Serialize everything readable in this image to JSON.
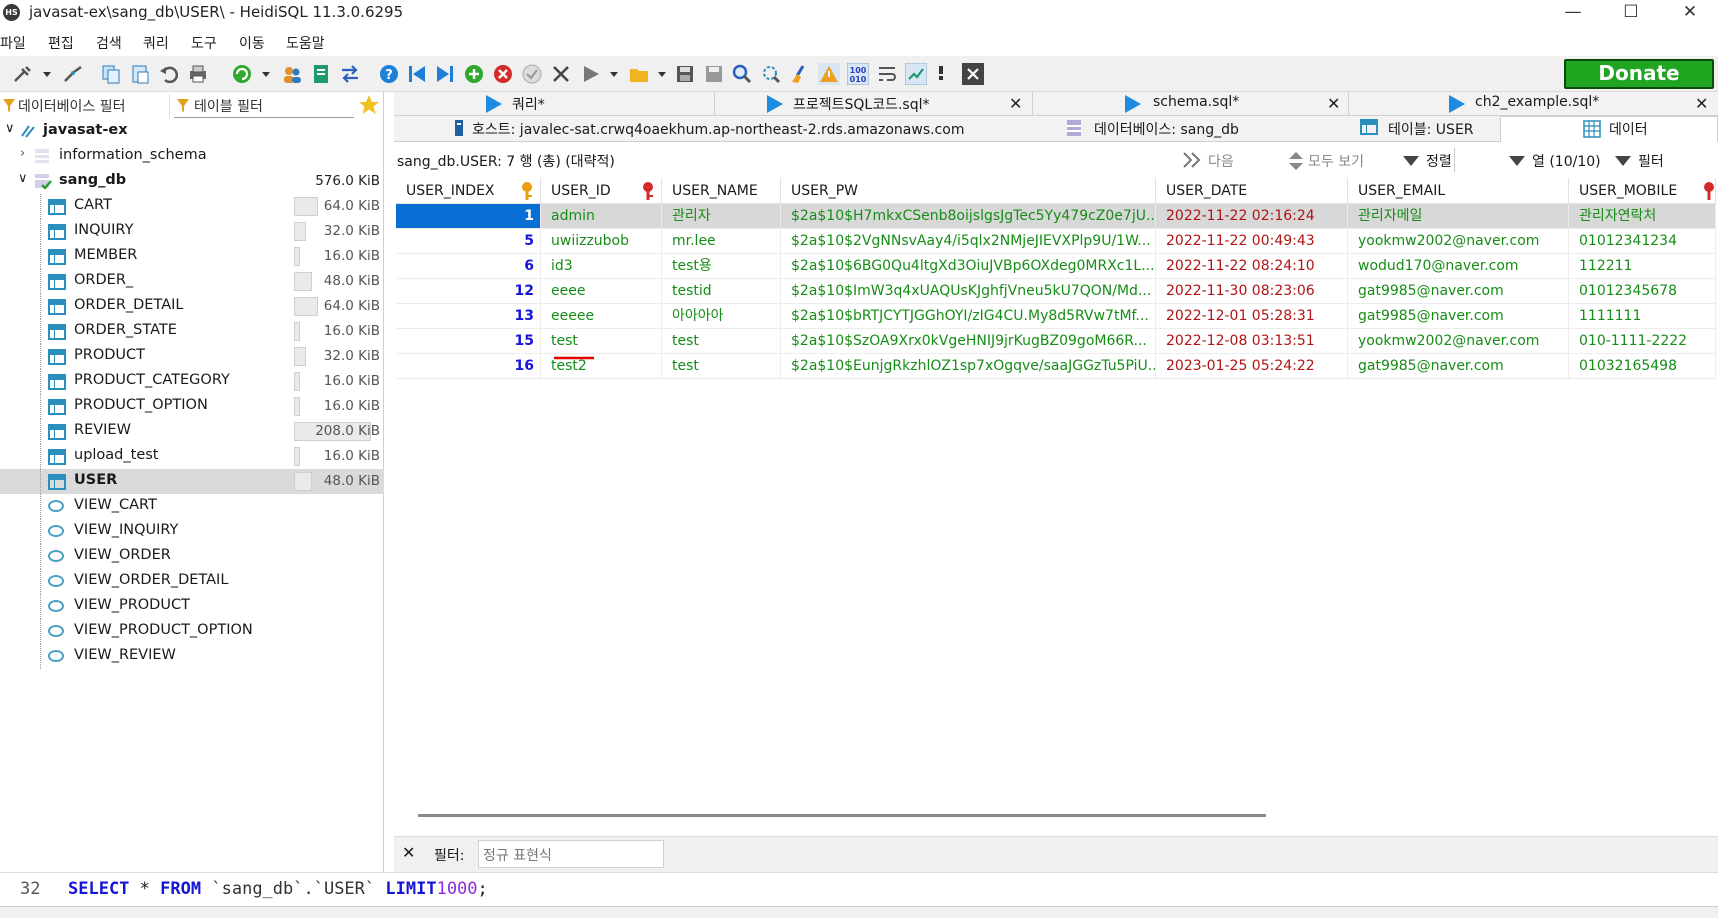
{
  "window": {
    "app_icon": "HS",
    "title": "javasat-ex\\sang_db\\USER\\ - HeidiSQL 11.3.0.6295",
    "minimize": "—",
    "maximize": "☐",
    "close": "✕"
  },
  "menu": [
    "파일",
    "편집",
    "검색",
    "쿼리",
    "도구",
    "이동",
    "도움말"
  ],
  "toolbar": {
    "donate_label": "Donate",
    "icons": [
      "connect-icon",
      "dropdown-icon",
      "disconnect-icon",
      "copy-icon",
      "paste-icon",
      "undo-icon",
      "print-icon",
      "refresh-icon",
      "dropdown-icon",
      "user-manager-icon",
      "export-icon",
      "transfer-icon",
      "help-icon",
      "first-record-icon",
      "last-record-icon",
      "add-record-icon",
      "delete-record-icon",
      "post-icon",
      "cancel-icon",
      "run-icon",
      "dropdown-icon",
      "open-file-icon",
      "dropdown-icon",
      "save-icon",
      "save-as-icon",
      "find-icon",
      "replace-icon",
      "clean-icon",
      "warning-icon",
      "binary-icon",
      "wrap-icon",
      "sync-icon",
      "comment-icon",
      "close-tab-icon"
    ]
  },
  "left_panel": {
    "db_filter_placeholder": "데이터베이스 필터",
    "table_filter_placeholder": "테이블 필터",
    "connection": "javasat-ex",
    "databases": [
      {
        "name": "information_schema",
        "size": ""
      },
      {
        "name": "sang_db",
        "size": "576.0 KiB"
      }
    ],
    "tables": [
      {
        "name": "CART",
        "size": "64.0 KiB",
        "kind": "table",
        "fill": 0.31
      },
      {
        "name": "INQUIRY",
        "size": "32.0 KiB",
        "kind": "table",
        "fill": 0.15
      },
      {
        "name": "MEMBER",
        "size": "16.0 KiB",
        "kind": "table",
        "fill": 0.08
      },
      {
        "name": "ORDER_",
        "size": "48.0 KiB",
        "kind": "table",
        "fill": 0.23
      },
      {
        "name": "ORDER_DETAIL",
        "size": "64.0 KiB",
        "kind": "table",
        "fill": 0.31
      },
      {
        "name": "ORDER_STATE",
        "size": "16.0 KiB",
        "kind": "table",
        "fill": 0.08
      },
      {
        "name": "PRODUCT",
        "size": "32.0 KiB",
        "kind": "table",
        "fill": 0.15
      },
      {
        "name": "PRODUCT_CATEGORY",
        "size": "16.0 KiB",
        "kind": "table",
        "fill": 0.08
      },
      {
        "name": "PRODUCT_OPTION",
        "size": "16.0 KiB",
        "kind": "table",
        "fill": 0.08
      },
      {
        "name": "REVIEW",
        "size": "208.0 KiB",
        "kind": "table",
        "fill": 1.0
      },
      {
        "name": "upload_test",
        "size": "16.0 KiB",
        "kind": "table",
        "fill": 0.08
      },
      {
        "name": "USER",
        "size": "48.0 KiB",
        "kind": "table",
        "fill": 0.23
      },
      {
        "name": "VIEW_CART",
        "size": "",
        "kind": "view"
      },
      {
        "name": "VIEW_INQUIRY",
        "size": "",
        "kind": "view"
      },
      {
        "name": "VIEW_ORDER",
        "size": "",
        "kind": "view"
      },
      {
        "name": "VIEW_ORDER_DETAIL",
        "size": "",
        "kind": "view"
      },
      {
        "name": "VIEW_PRODUCT",
        "size": "",
        "kind": "view"
      },
      {
        "name": "VIEW_PRODUCT_OPTION",
        "size": "",
        "kind": "view"
      },
      {
        "name": "VIEW_REVIEW",
        "size": "",
        "kind": "view"
      }
    ]
  },
  "query_tabs": [
    {
      "label": "쿼리*",
      "closable": false
    },
    {
      "label": "프로젝트SQL코드.sql*",
      "closable": true
    },
    {
      "label": "schema.sql*",
      "closable": true
    },
    {
      "label": "ch2_example.sql*",
      "closable": true
    }
  ],
  "object_tabs": [
    {
      "label": "호스트: javalec-sat.crwq4oaekhum.ap-northeast-2.rds.amazonaws.com"
    },
    {
      "label": "데이터베이스: sang_db"
    },
    {
      "label": "테이블: USER"
    },
    {
      "label": "데이터"
    }
  ],
  "data_view": {
    "summary": "sang_db.USER: 7 행 (총) (대략적)",
    "next": "다음",
    "show_all": "모두 보기",
    "sort": "정렬",
    "columns": "열 (10/10)",
    "filter": "필터"
  },
  "grid": {
    "columns": [
      "USER_INDEX",
      "USER_ID",
      "USER_NAME",
      "USER_PW",
      "USER_DATE",
      "USER_EMAIL",
      "USER_MOBILE"
    ],
    "rows": [
      [
        "1",
        "admin",
        "관리자",
        "$2a$10$H7mkxCSenb8oijslgsJgTec5Yy479cZ0e7jU...",
        "2022-11-22 02:16:24",
        "관리자메일",
        "관리자연락처"
      ],
      [
        "5",
        "uwiizzubob",
        "mr.lee",
        "$2a$10$2VgNNsvAay4/i5qlx2NMjeJIEVXPlp9U/1W...",
        "2022-11-22 00:49:43",
        "yookmw2002@naver.com",
        "01012341234"
      ],
      [
        "6",
        "id3",
        "test용",
        "$2a$10$6BG0Qu4ltgXd3OiuJVBp6OXdeg0MRXc1L...",
        "2022-11-22 08:24:10",
        "wodud170@naver.com",
        "112211"
      ],
      [
        "12",
        "eeee",
        "testid",
        "$2a$10$ImW3q4xUAQUsKJghfjVneu5kU7QON/Md...",
        "2022-11-30 08:23:06",
        "gat9985@naver.com",
        "01012345678"
      ],
      [
        "13",
        "eeeee",
        "아아아아",
        "$2a$10$bRTJCYTJGGhOYI/zIG4CU.My8d5RVw7tMf...",
        "2022-12-01 05:28:31",
        "gat9985@naver.com",
        "1111111"
      ],
      [
        "15",
        "test",
        "test",
        "$2a$10$SzOA9Xrx0kVgeHNIJ9jrKugBZ09goM66R...",
        "2022-12-08 03:13:51",
        "yookmw2002@naver.com",
        "010-1111-2222"
      ],
      [
        "16",
        "test2",
        "test",
        "$2a$10$EunjgRkzhlOZ1sp7xOgqve/saaJGGzTu5PiU...",
        "2023-01-25 05:24:22",
        "gat9985@naver.com",
        "01032165498"
      ]
    ]
  },
  "filter_bar": {
    "label": "필터:",
    "placeholder": "정규 표현식"
  },
  "sql_bar": {
    "line_number": "32",
    "kw_select": "SELECT",
    "star": "*",
    "kw_from": "FROM",
    "table_ref": "`sang_db`.`USER`",
    "kw_limit": "LIMIT",
    "limit_value": "1000",
    "terminator": ";"
  },
  "colors": {
    "donate_bg": "#1fa51f",
    "selection": "#0a6fd4",
    "keyword": "#1515d6",
    "string_green": "#168d16",
    "date_red": "#b01414",
    "annotation_red": "#e00000"
  }
}
